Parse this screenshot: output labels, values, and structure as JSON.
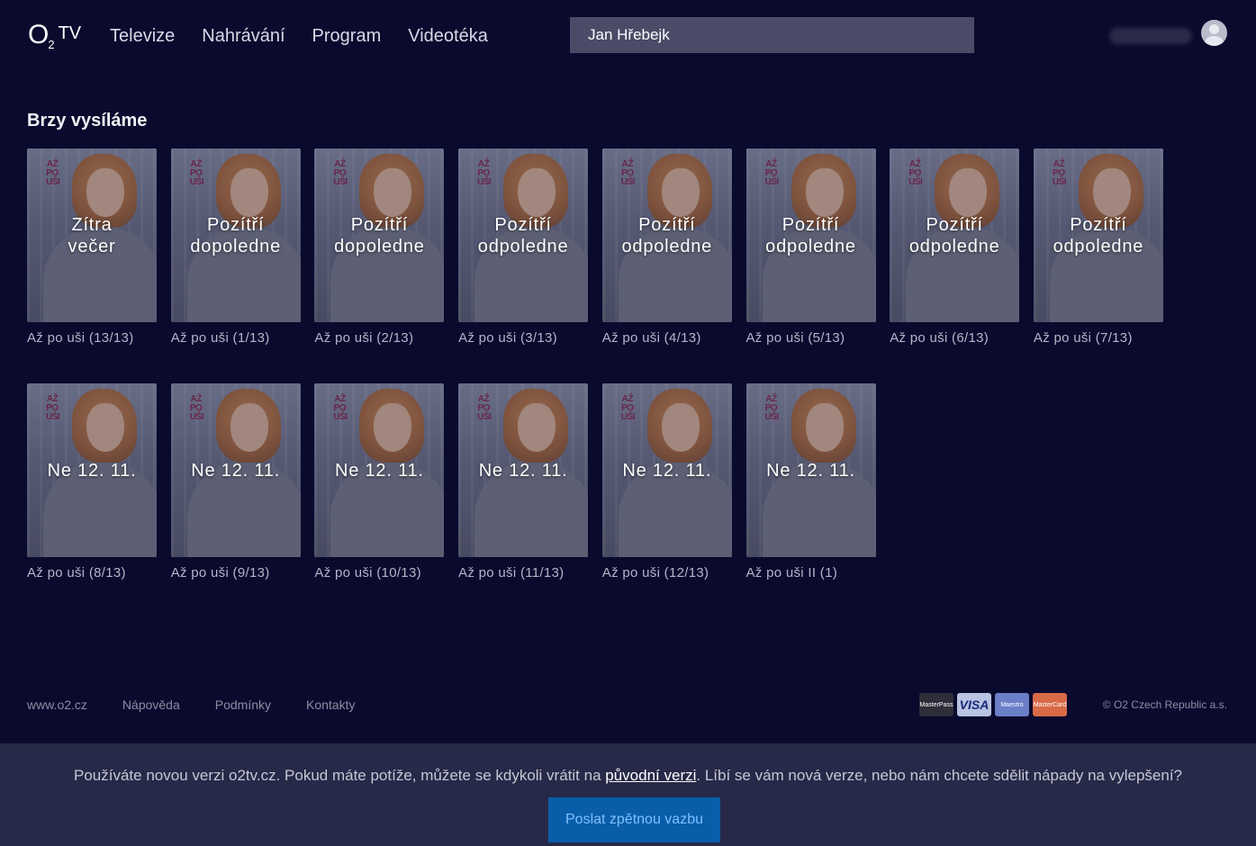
{
  "header": {
    "logo": {
      "o": "O",
      "two": "2",
      "tv": "TV"
    },
    "nav": [
      "Televize",
      "Nahrávání",
      "Program",
      "Videotéka"
    ],
    "search_value": "Jan Hřebejk"
  },
  "section": {
    "title": "Brzy vysíláme",
    "poster_badge": "AŽ\nPO\nUŠI",
    "row1": [
      {
        "when": "Zítra\nvečer",
        "caption": "Až po uši (13/13)"
      },
      {
        "when": "Pozítří\ndopoledne",
        "caption": "Až po uši (1/13)"
      },
      {
        "when": "Pozítří\ndopoledne",
        "caption": "Až po uši (2/13)"
      },
      {
        "when": "Pozítří\nodpoledne",
        "caption": "Až po uši (3/13)"
      },
      {
        "when": "Pozítří\nodpoledne",
        "caption": "Až po uši (4/13)"
      },
      {
        "when": "Pozítří\nodpoledne",
        "caption": "Až po uši (5/13)"
      },
      {
        "when": "Pozítří\nodpoledne",
        "caption": "Až po uši (6/13)"
      },
      {
        "when": "Pozítří\nodpoledne",
        "caption": "Až po uši (7/13)"
      }
    ],
    "row2": [
      {
        "when": "Ne 12. 11.",
        "caption": "Až po uši (8/13)"
      },
      {
        "when": "Ne 12. 11.",
        "caption": "Až po uši (9/13)"
      },
      {
        "when": "Ne 12. 11.",
        "caption": "Až po uši (10/13)"
      },
      {
        "when": "Ne 12. 11.",
        "caption": "Až po uši (11/13)"
      },
      {
        "when": "Ne 12. 11.",
        "caption": "Až po uši (12/13)"
      },
      {
        "when": "Ne 12. 11.",
        "caption": "Až po uši II (1)"
      }
    ]
  },
  "footer": {
    "links": [
      "www.o2.cz",
      "Nápověda",
      "Podmínky",
      "Kontakty"
    ],
    "cards": [
      {
        "name": "mastercard-accepted-icon",
        "label": "MasterPass"
      },
      {
        "name": "visa-icon",
        "label": "VISA"
      },
      {
        "name": "maestro-icon",
        "label": "Maestro"
      },
      {
        "name": "mastercard-icon",
        "label": "MasterCard"
      }
    ],
    "copyright": "© O2 Czech Republic a.s."
  },
  "feedback": {
    "text_before": "Používáte novou verzi o2tv.cz. Pokud máte potíže, můžete se kdykoli vrátit na ",
    "link": "původní verzi",
    "text_after": ". Líbí se vám nová verze, nebo nám chcete sdělit nápady na vylepšení?",
    "button": "Poslat zpětnou vazbu"
  }
}
